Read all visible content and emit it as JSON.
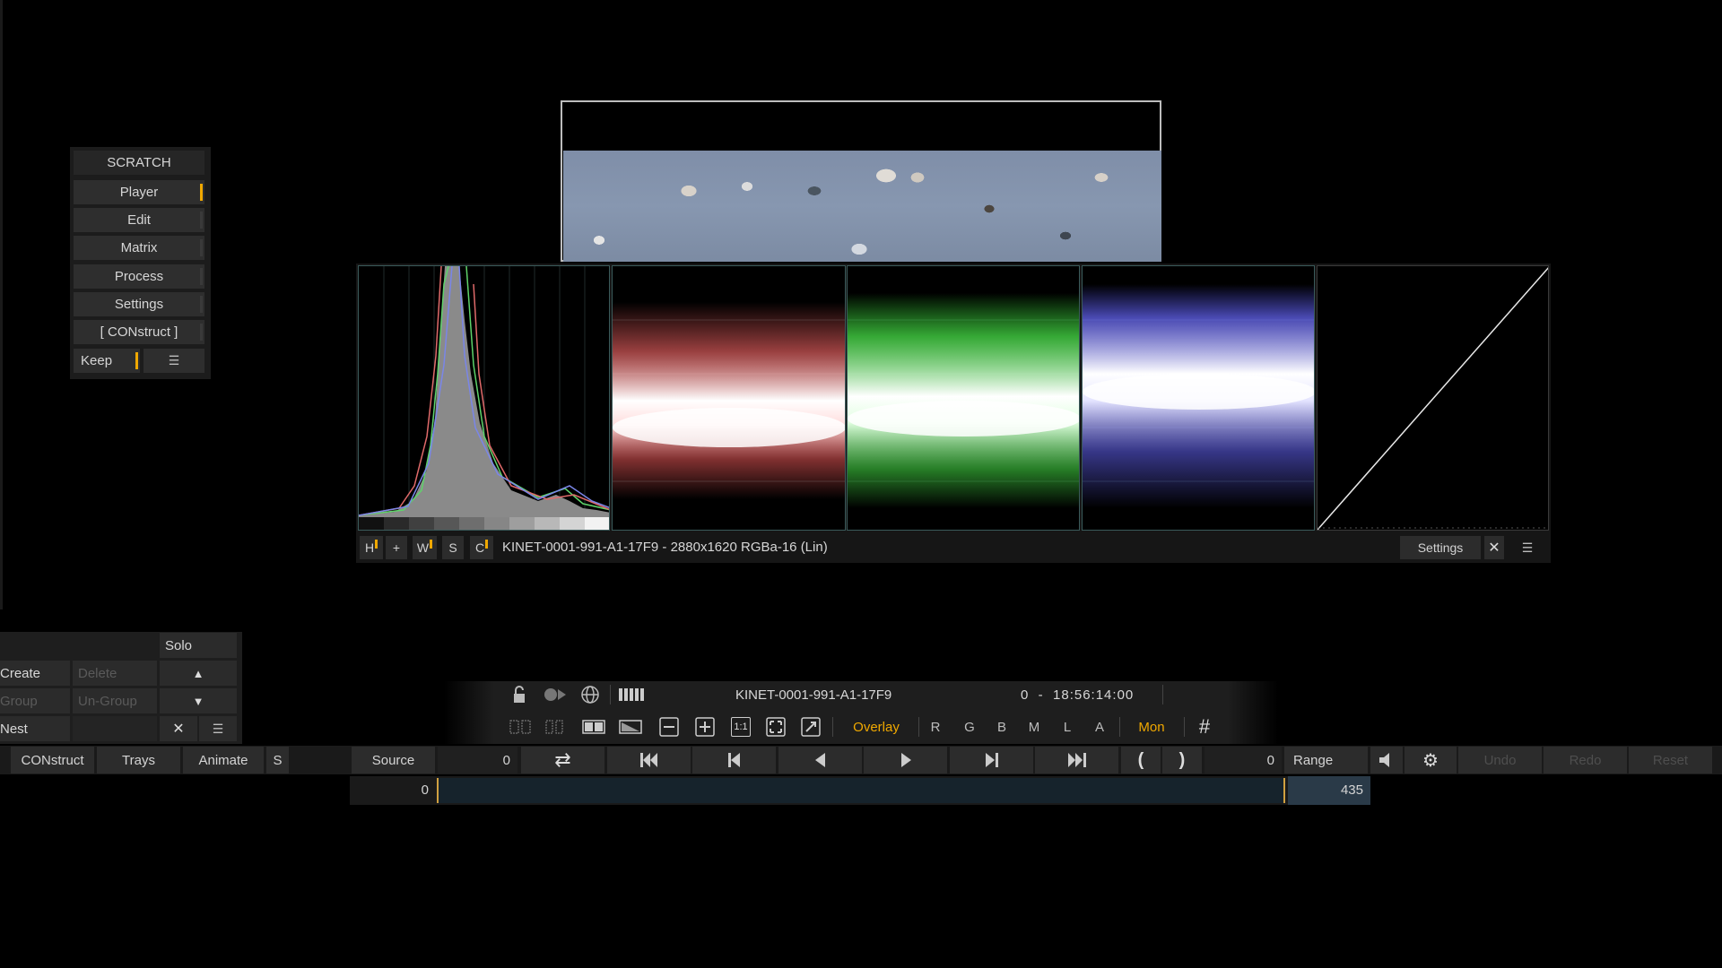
{
  "menu": {
    "title": "SCRATCH",
    "items": [
      {
        "label": "Player",
        "active": true
      },
      {
        "label": "Edit",
        "active": false
      },
      {
        "label": "Matrix",
        "active": false
      },
      {
        "label": "Process",
        "active": false
      },
      {
        "label": "Settings",
        "active": false
      },
      {
        "label": "[ CONstruct ]",
        "active": false
      }
    ],
    "keep_label": "Keep"
  },
  "scopes": {
    "toggles": [
      "H",
      "+",
      "W",
      "S",
      "C"
    ],
    "clip_info": "KINET-0001-991-A1-17F9 - 2880x1620 RGBa-16 (Lin)",
    "settings_label": "Settings"
  },
  "left_panel": {
    "solo": "Solo",
    "create": "Create",
    "delete": "Delete",
    "group": "Group",
    "ungroup": "Un-Group",
    "nest": "Nest"
  },
  "transport": {
    "clip_name": "KINET-0001-991-A1-17F9",
    "timecode": "0  -  18:56:14:00",
    "overlay": "Overlay",
    "channels": [
      "R",
      "G",
      "B",
      "M",
      "L",
      "A"
    ],
    "mon": "Mon",
    "one_to_one": "1:1"
  },
  "bottom_bar": {
    "construct": "CONstruct",
    "trays": "Trays",
    "animate": "Animate",
    "s": "S",
    "source": "Source",
    "source_value": "0",
    "range_value": "0",
    "range": "Range",
    "undo": "Undo",
    "redo": "Redo",
    "reset": "Reset"
  },
  "timeline": {
    "start": "0",
    "end": "435"
  },
  "colors": {
    "accent": "#f0a800",
    "panel": "#2b2b2b",
    "background": "#000000"
  }
}
